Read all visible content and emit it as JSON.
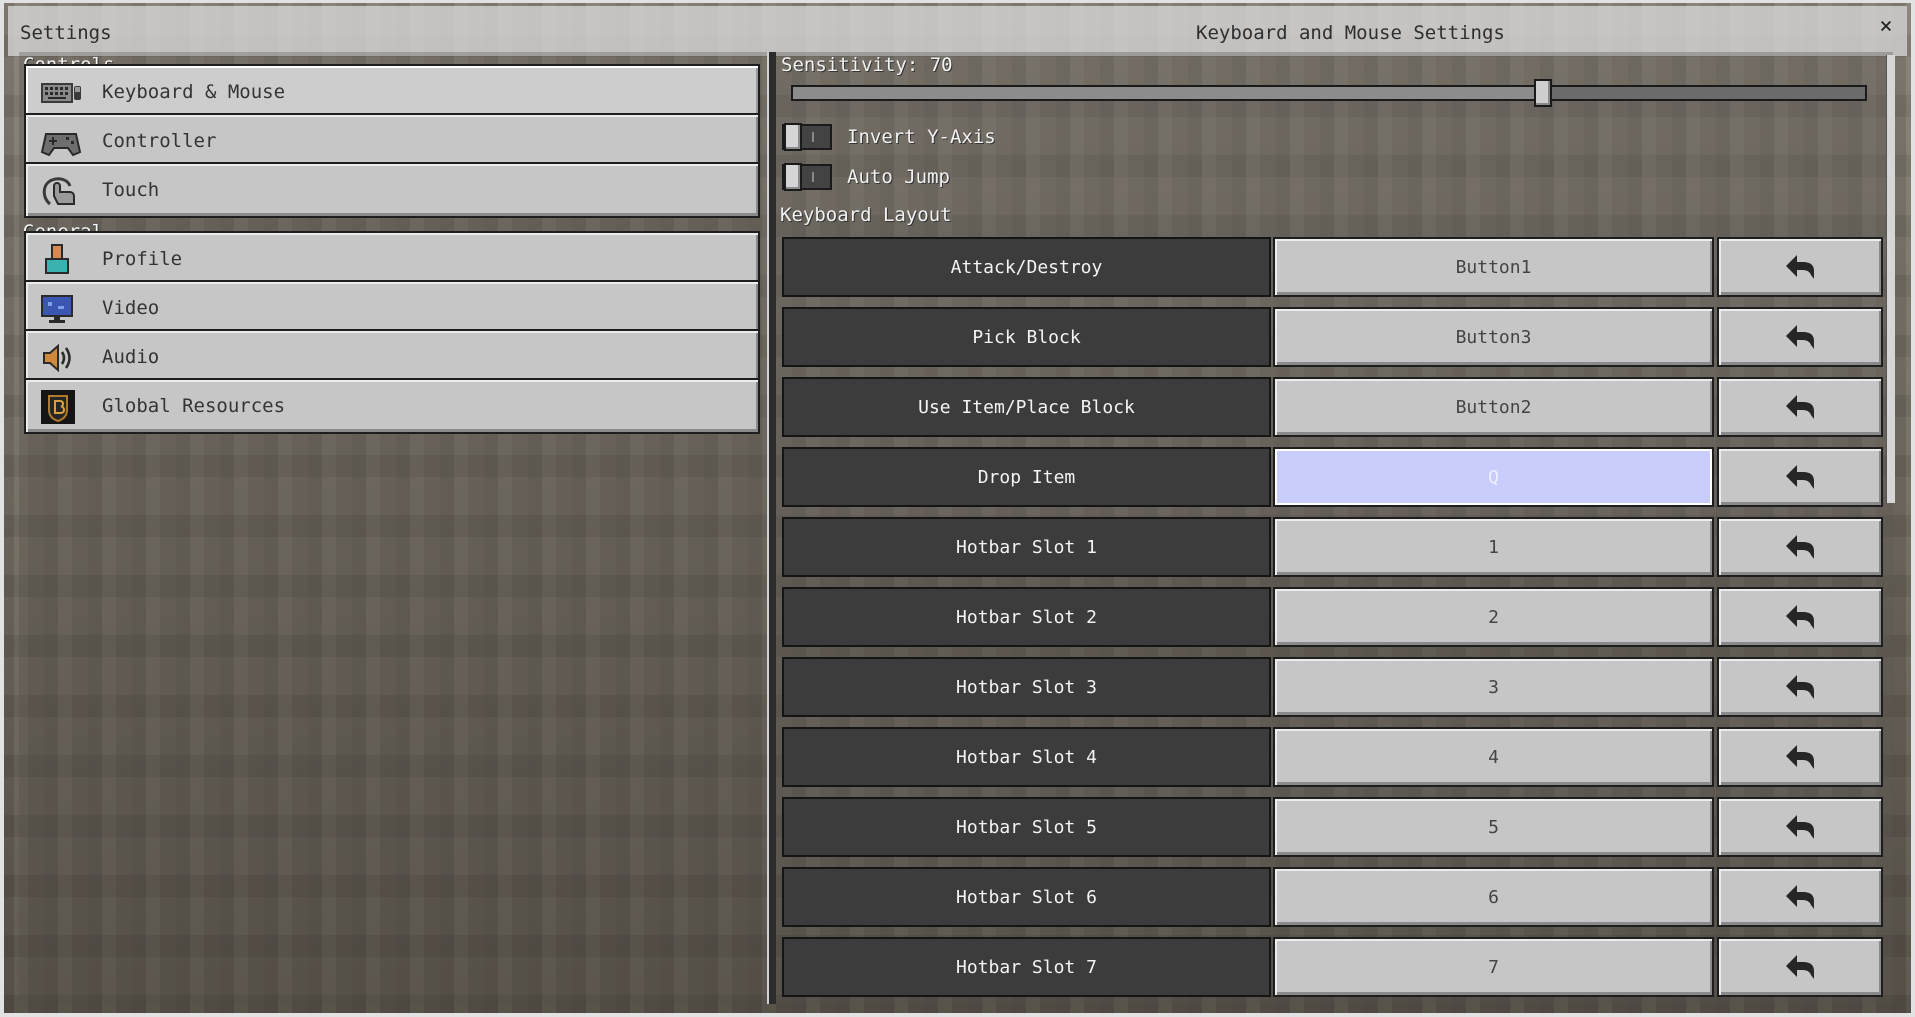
{
  "window": {
    "title_left": "Settings",
    "title_center": "Keyboard and Mouse Settings",
    "close_icon": "×"
  },
  "sidebar": {
    "controls_header": "Controls",
    "general_header": "General",
    "items": [
      {
        "label": "Keyboard & Mouse",
        "icon": "keyboard-icon",
        "selected": true
      },
      {
        "label": "Controller",
        "icon": "gamepad-icon"
      },
      {
        "label": "Touch",
        "icon": "touch-icon"
      },
      {
        "label": "Profile",
        "icon": "profile-icon"
      },
      {
        "label": "Video",
        "icon": "monitor-icon"
      },
      {
        "label": "Audio",
        "icon": "speaker-icon"
      },
      {
        "label": "Global Resources",
        "icon": "resource-pack-icon"
      }
    ]
  },
  "settings": {
    "sensitivity_label": "Sensitivity: 70",
    "sensitivity_value": 70,
    "sensitivity_max": 100,
    "invert_y_label": "Invert Y-Axis",
    "invert_y_on": false,
    "auto_jump_label": "Auto Jump",
    "auto_jump_on": false,
    "layout_label": "Keyboard Layout"
  },
  "bindings": [
    {
      "action": "Attack/Destroy",
      "key": "Button1"
    },
    {
      "action": "Pick Block",
      "key": "Button3"
    },
    {
      "action": "Use Item/Place Block",
      "key": "Button2"
    },
    {
      "action": "Drop Item",
      "key": "Q",
      "active": true
    },
    {
      "action": "Hotbar Slot 1",
      "key": "1"
    },
    {
      "action": "Hotbar Slot 2",
      "key": "2"
    },
    {
      "action": "Hotbar Slot 3",
      "key": "3"
    },
    {
      "action": "Hotbar Slot 4",
      "key": "4"
    },
    {
      "action": "Hotbar Slot 5",
      "key": "5"
    },
    {
      "action": "Hotbar Slot 6",
      "key": "6"
    },
    {
      "action": "Hotbar Slot 7",
      "key": "7"
    }
  ],
  "colors": {
    "active_key_bg": "#c9cdfc",
    "action_bg": "#3c3c3c",
    "button_bg": "#c6c6c6"
  }
}
